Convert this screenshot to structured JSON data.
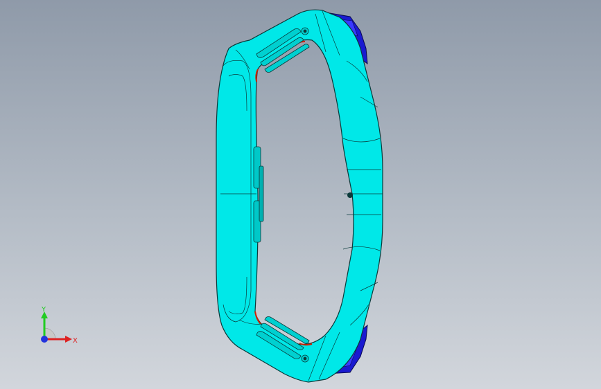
{
  "viewport": {
    "background_top": "#8f9aa9",
    "background_bottom": "#d2d6dc"
  },
  "model": {
    "body_color": "#00e8e8",
    "edge_color": "#0a3a3a",
    "accent_blue": "#1a1ad0",
    "accent_red": "#d02000"
  },
  "triad": {
    "y_label": "Y",
    "x_label": "X",
    "y_color": "#22cc22",
    "x_color": "#dd2222",
    "z_color": "#2233dd"
  }
}
